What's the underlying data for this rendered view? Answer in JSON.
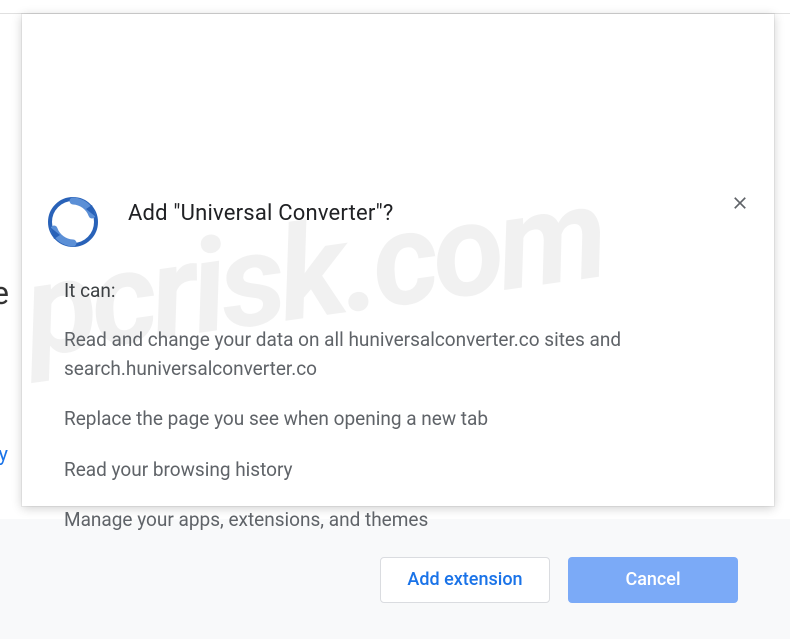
{
  "dialog": {
    "title": "Add \"Universal Converter\"?",
    "intro": "It can:",
    "permissions": [
      "Read and change your data on all huniversalconverter.co sites and search.huniversalconverter.co",
      "Replace the page you see when opening a new tab",
      "Read your browsing history",
      "Manage your apps, extensions, and themes"
    ],
    "buttons": {
      "add": "Add extension",
      "cancel": "Cancel"
    }
  },
  "background": {
    "partial_text": "e",
    "partial_link": "ty"
  },
  "watermark": "pcrisk.com"
}
